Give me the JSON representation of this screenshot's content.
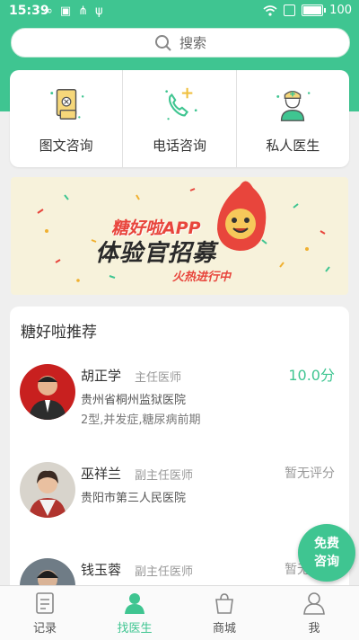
{
  "status": {
    "time": "15:39",
    "battery": "100"
  },
  "search": {
    "placeholder": "搜索"
  },
  "categories": [
    {
      "label": "图文咨询",
      "icon": "document-icon"
    },
    {
      "label": "电话咨询",
      "icon": "phone-icon"
    },
    {
      "label": "私人医生",
      "icon": "doctor-icon"
    }
  ],
  "banner": {
    "line1": "糖好啦APP",
    "line2": "体验官招募",
    "line3": "火热进行中"
  },
  "recommend": {
    "title": "糖好啦推荐",
    "doctors": [
      {
        "name": "胡正学",
        "title": "主任医师",
        "score": "10.0分",
        "hospital": "贵州省桐州监狱医院",
        "tags": "2型,并发症,糖尿病前期"
      },
      {
        "name": "巫祥兰",
        "title": "副主任医师",
        "score": "暂无评分",
        "hospital": "贵阳市第三人民医院",
        "tags": ""
      },
      {
        "name": "钱玉蓉",
        "title": "副主任医师",
        "score": "暂无评分",
        "hospital": "",
        "tags": ""
      }
    ]
  },
  "fab": {
    "line1": "免费",
    "line2": "咨询"
  },
  "tabs": [
    {
      "label": "记录",
      "icon": "record-icon"
    },
    {
      "label": "找医生",
      "icon": "find-doctor-icon"
    },
    {
      "label": "商城",
      "icon": "shop-bag-icon"
    },
    {
      "label": "我",
      "icon": "user-icon"
    }
  ],
  "colors": {
    "accent": "#3fc591",
    "score": "#3fc591"
  }
}
